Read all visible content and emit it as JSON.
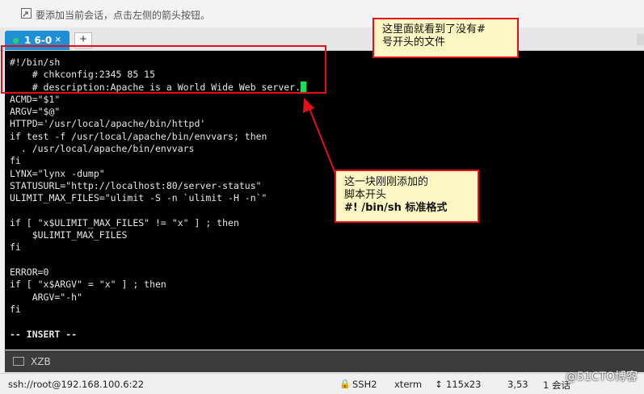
{
  "hint": {
    "text": "要添加当前会话，点击左侧的箭头按钮。"
  },
  "tabs": {
    "active_label": "1 6-0",
    "close_glyph": "×",
    "add_glyph": "+"
  },
  "terminal": {
    "lines": [
      "#!/bin/sh",
      "    # chkconfig:2345 85 15",
      "    # description:Apache is a World Wide Web server.",
      "ACMD=\"$1\"",
      "ARGV=\"$@\"",
      "HTTPD='/usr/local/apache/bin/httpd'",
      "if test -f /usr/local/apache/bin/envvars; then",
      "  . /usr/local/apache/bin/envvars",
      "fi",
      "LYNX=\"lynx -dump\"",
      "STATUSURL=\"http://localhost:80/server-status\"",
      "ULIMIT_MAX_FILES=\"ulimit -S -n `ulimit -H -n`\"",
      "",
      "if [ \"x$ULIMIT_MAX_FILES\" != \"x\" ] ; then",
      "    $ULIMIT_MAX_FILES",
      "fi",
      "",
      "ERROR=0",
      "if [ \"x$ARGV\" = \"x\" ] ; then",
      "    ARGV=\"-h\"",
      "fi",
      "",
      "-- INSERT --"
    ],
    "cursor_color": "#18e05a"
  },
  "annotations": {
    "top_note": {
      "line1": "这里面就看到了没有#",
      "line2": "号开头的文件"
    },
    "bottom_note": {
      "line1": "这一块刚刚添加的",
      "line2": "脚本开头",
      "line3": "#! /bin/sh  标准格式"
    }
  },
  "session": {
    "name": "XZB"
  },
  "status": {
    "connection": "ssh://root@192.168.100.6:22",
    "protocol": "SSH2",
    "terminal_type": "xterm",
    "size": "115x23",
    "cursor_pos": "3,53",
    "sessions": "1 会话"
  },
  "watermark": "@51CTO博客",
  "colors": {
    "tab_active": "#1f8fd6",
    "annotation_border": "#e3101a",
    "note_bg": "#fdf8c3",
    "terminal_bg": "#000000"
  }
}
